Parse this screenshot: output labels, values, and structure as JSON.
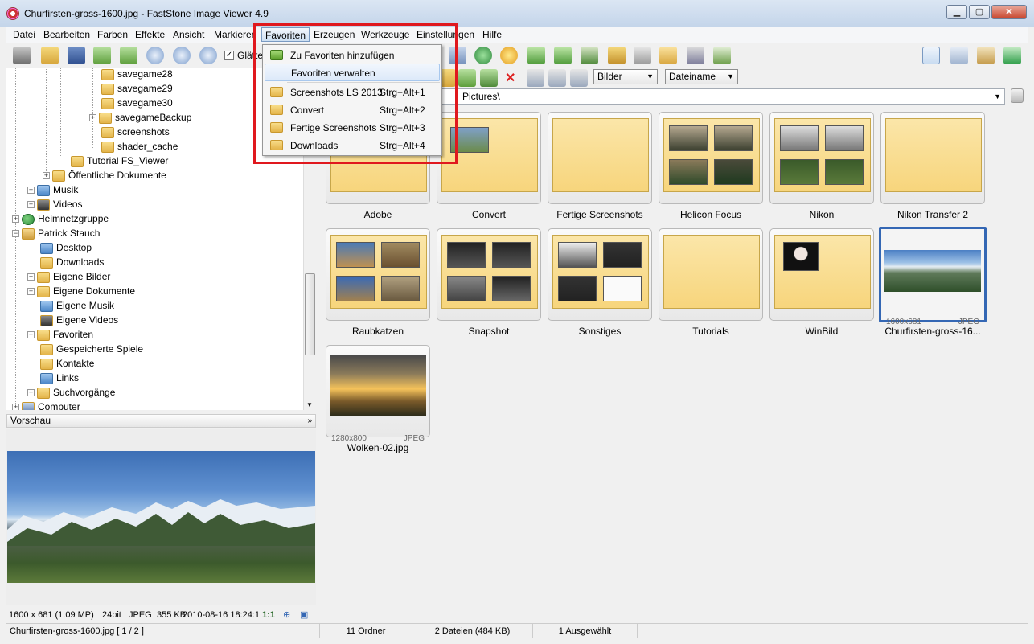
{
  "window": {
    "title": "Churfirsten-gross-1600.jpg  -  FastStone Image Viewer 4.9",
    "min_label": "▁",
    "max_label": "▢",
    "close_label": "✕"
  },
  "menubar": [
    "Datei",
    "Bearbeiten",
    "Farben",
    "Effekte",
    "Ansicht",
    "Markieren",
    "Favoriten",
    "Erzeugen",
    "Werkzeuge",
    "Einstellungen",
    "Hilfe"
  ],
  "toolbar": {
    "smooth_label": "Glätte"
  },
  "favorites_menu": {
    "items": [
      {
        "label": "Zu Favoriten hinzufügen",
        "shortcut": ""
      },
      {
        "label": "Favoriten verwalten",
        "shortcut": ""
      },
      {
        "label": "Screenshots LS 2013",
        "shortcut": "Strg+Alt+1"
      },
      {
        "label": "Convert",
        "shortcut": "Strg+Alt+2"
      },
      {
        "label": "Fertige Screenshots",
        "shortcut": "Strg+Alt+3"
      },
      {
        "label": "Downloads",
        "shortcut": "Strg+Alt+4"
      }
    ]
  },
  "tree": {
    "items": [
      {
        "label": "savegame28",
        "icon": "folder"
      },
      {
        "label": "savegame29",
        "icon": "folder"
      },
      {
        "label": "savegame30",
        "icon": "folder"
      },
      {
        "label": "savegameBackup",
        "icon": "folder"
      },
      {
        "label": "screenshots",
        "icon": "folder"
      },
      {
        "label": "shader_cache",
        "icon": "folder"
      },
      {
        "label": "Tutorial FS_Viewer",
        "icon": "folder"
      },
      {
        "label": "Öffentliche Dokumente",
        "icon": "folder"
      },
      {
        "label": "Musik",
        "icon": "music"
      },
      {
        "label": "Videos",
        "icon": "video"
      },
      {
        "label": "Heimnetzgruppe",
        "icon": "network"
      },
      {
        "label": "Patrick Stauch",
        "icon": "user-folder"
      },
      {
        "label": "Desktop",
        "icon": "folder"
      },
      {
        "label": "Downloads",
        "icon": "folder"
      },
      {
        "label": "Eigene Bilder",
        "icon": "folder"
      },
      {
        "label": "Eigene Dokumente",
        "icon": "folder"
      },
      {
        "label": "Eigene Musik",
        "icon": "folder"
      },
      {
        "label": "Eigene Videos",
        "icon": "folder"
      },
      {
        "label": "Favoriten",
        "icon": "folder"
      },
      {
        "label": "Gespeicherte Spiele",
        "icon": "folder"
      },
      {
        "label": "Kontakte",
        "icon": "folder"
      },
      {
        "label": "Links",
        "icon": "folder"
      },
      {
        "label": "Suchvorgänge",
        "icon": "folder"
      },
      {
        "label": "Computer",
        "icon": "computer"
      }
    ]
  },
  "preview": {
    "header": "Vorschau",
    "info": {
      "dims": "1600 x 681 (1.09 MP)",
      "bits": "24bit",
      "format": "JPEG",
      "size": "355 KB",
      "date": "2010-08-16 18:24:1",
      "zoom": "1:1"
    }
  },
  "options": {
    "view_select": "Bilder",
    "sort_select": "Dateiname"
  },
  "address": {
    "path": "Pictures\\"
  },
  "thumbnails": [
    {
      "label": "Adobe",
      "type": "folder"
    },
    {
      "label": "Convert",
      "type": "folder"
    },
    {
      "label": "Fertige Screenshots",
      "type": "folder"
    },
    {
      "label": "Helicon Focus",
      "type": "folder"
    },
    {
      "label": "Nikon",
      "type": "folder"
    },
    {
      "label": "Nikon Transfer 2",
      "type": "folder"
    },
    {
      "label": "Raubkatzen",
      "type": "folder"
    },
    {
      "label": "Snapshot",
      "type": "folder"
    },
    {
      "label": "Sonstiges",
      "type": "folder"
    },
    {
      "label": "Tutorials",
      "type": "folder"
    },
    {
      "label": "WinBild",
      "type": "folder"
    },
    {
      "label": "Churfirsten-gross-16...",
      "type": "image",
      "dims": "1600x681",
      "format": "JPEG",
      "selected": true
    },
    {
      "label": "Wolken-02.jpg",
      "type": "image",
      "dims": "1280x800",
      "format": "JPEG"
    }
  ],
  "statusbar": {
    "file": "Churfirsten-gross-1600.jpg [ 1 / 2 ]",
    "folders": "11 Ordner",
    "files": "2 Dateien (484 KB)",
    "selected": "1 Ausgewählt"
  },
  "colors": {
    "accent": "#3467b4",
    "highlight_box": "#e0181e",
    "folder_fill": "#f7d57c"
  }
}
